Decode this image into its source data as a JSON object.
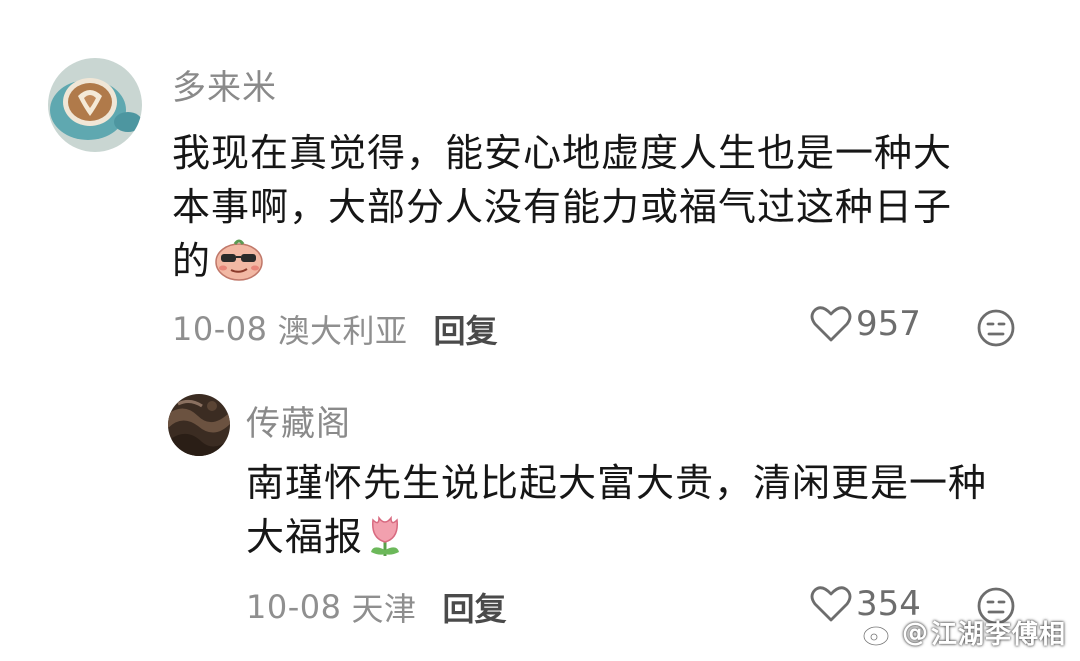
{
  "comments": [
    {
      "username": "多来米",
      "content_lines": [
        "我现在真觉得，能安心地虚度人生也是一种大",
        "本事啊，大部分人没有能力或福气过这种日子",
        "的"
      ],
      "emoji": "smug-face-emoji",
      "date": "10-08",
      "location": "澳大利亚",
      "reply_label": "回复",
      "like_count": "957",
      "avatar": "latte-art-avatar"
    },
    {
      "username": "传藏阁",
      "content_lines": [
        "南瑾怀先生说比起大富大贵，清闲更是一种",
        "大福报"
      ],
      "emoji": "tulip-emoji",
      "date": "10-08",
      "location": "天津",
      "reply_label": "回复",
      "like_count": "354",
      "avatar": "stone-texture-avatar"
    }
  ],
  "watermark": {
    "icon": "weibo-icon",
    "text": "江湖李傅相"
  },
  "colors": {
    "username": "#8a8a8a",
    "content": "#161616",
    "meta": "#8f8f8f",
    "reply": "#4a4a4a"
  }
}
